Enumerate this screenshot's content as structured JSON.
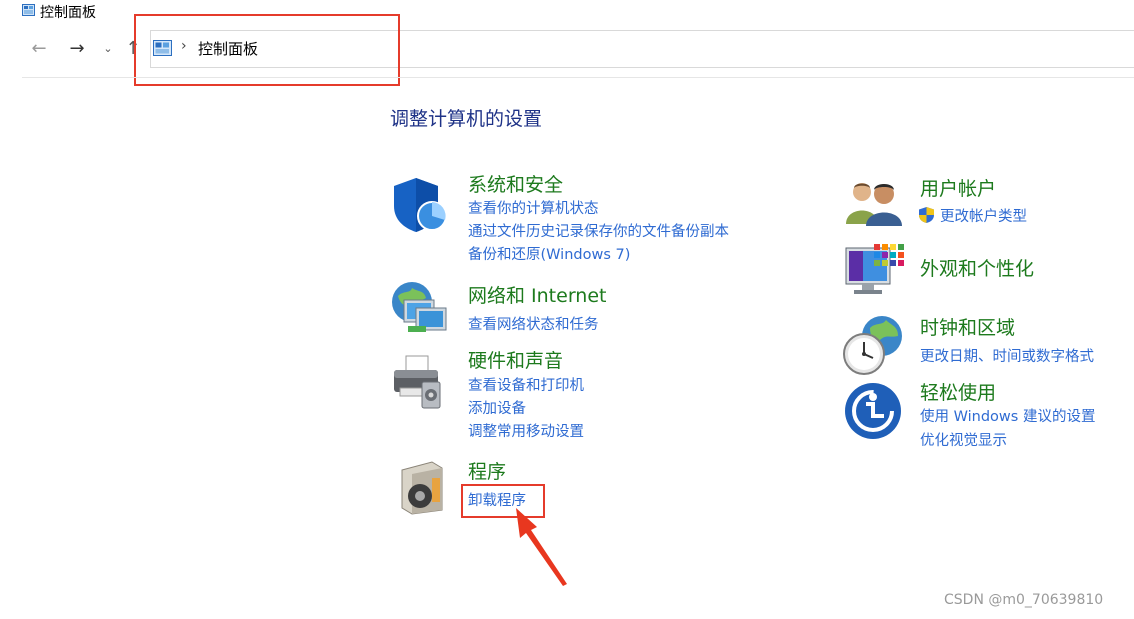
{
  "window": {
    "title": "控制面板",
    "icon": "control-panel-icon"
  },
  "nav": {
    "back_icon": "arrow-left-icon",
    "forward_icon": "arrow-right-icon",
    "recent_icon": "chevron-down-icon",
    "up_icon": "arrow-up-icon"
  },
  "address": {
    "separator": "›",
    "path": "控制面板"
  },
  "heading": "调整计算机的设置",
  "categories": {
    "system": {
      "title": "系统和安全",
      "links": [
        "查看你的计算机状态",
        "通过文件历史记录保存你的文件备份副本",
        "备份和还原(Windows 7)"
      ]
    },
    "network": {
      "title": "网络和 Internet",
      "links": [
        "查看网络状态和任务"
      ]
    },
    "hardware": {
      "title": "硬件和声音",
      "links": [
        "查看设备和打印机",
        "添加设备",
        "调整常用移动设置"
      ]
    },
    "programs": {
      "title": "程序",
      "links": [
        "卸载程序"
      ]
    },
    "accounts": {
      "title": "用户帐户",
      "links": [
        "更改帐户类型"
      ]
    },
    "appearance": {
      "title": "外观和个性化",
      "links": []
    },
    "clock": {
      "title": "时钟和区域",
      "links": [
        "更改日期、时间或数字格式"
      ]
    },
    "ease": {
      "title": "轻松使用",
      "links": [
        "使用 Windows 建议的设置",
        "优化视觉显示"
      ]
    }
  },
  "colors": {
    "title_green": "#1d7a1d",
    "link_blue": "#2f6bd2",
    "heading_blue": "#1e3287",
    "highlight_red": "#e53b2b"
  },
  "watermark": "CSDN @m0_70639810"
}
